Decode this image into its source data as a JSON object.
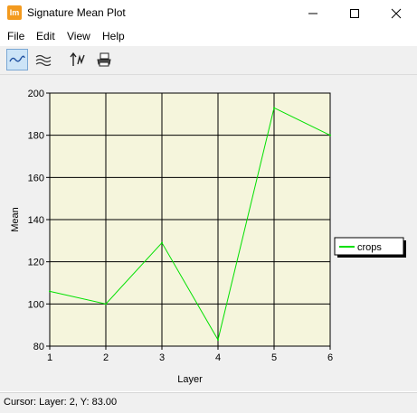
{
  "window": {
    "title": "Signature Mean Plot",
    "icon_label": "Im"
  },
  "menu": {
    "items": [
      "File",
      "Edit",
      "View",
      "Help"
    ]
  },
  "toolbar": {
    "buttons": [
      "single-line-plot-icon",
      "multi-line-plot-icon",
      "switch-axis-icon",
      "print-icon"
    ]
  },
  "chart_data": {
    "type": "line",
    "x": [
      1,
      2,
      3,
      4,
      5,
      6
    ],
    "series": [
      {
        "name": "crops",
        "values": [
          106,
          100,
          129,
          83,
          193,
          180
        ],
        "color": "#00e000"
      }
    ],
    "xlabel": "Layer",
    "ylabel": "Mean",
    "xlim": [
      1,
      6
    ],
    "ylim": [
      80,
      200
    ],
    "xticks": [
      "1",
      "2",
      "3",
      "4",
      "5",
      "6"
    ],
    "yticks": [
      "80",
      "100",
      "120",
      "140",
      "160",
      "180",
      "200"
    ],
    "grid": true,
    "plot_background": "#f5f5dc",
    "legend_position": "right"
  },
  "status": {
    "text": "Cursor: Layer: 2, Y: 83.00"
  }
}
